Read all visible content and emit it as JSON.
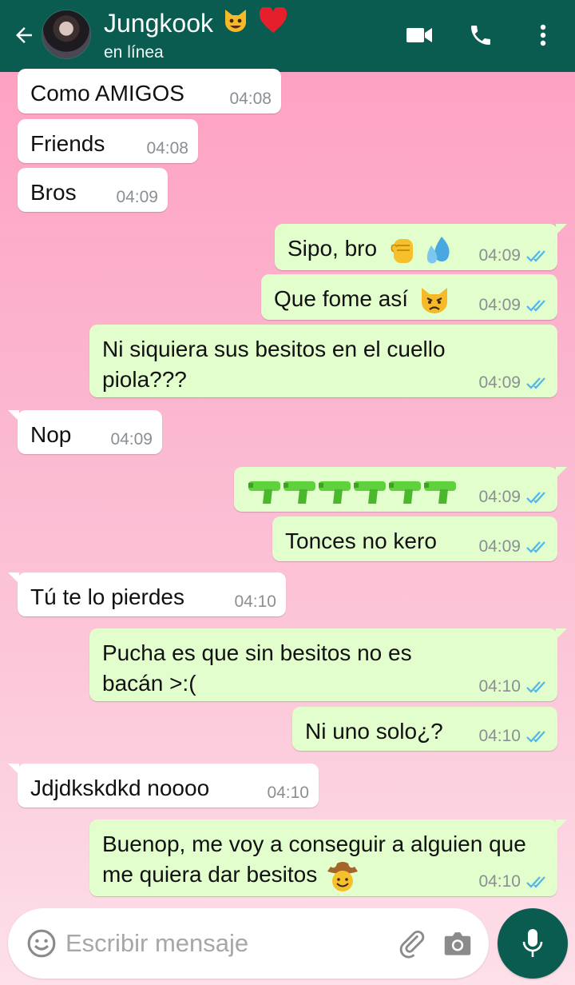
{
  "header": {
    "contact_name": "Jungkook",
    "status": "en línea",
    "name_emojis": [
      "smiling-cat-emoji",
      "red-heart-emoji"
    ],
    "bg_color": "#0b5c50",
    "actions": [
      "video-call-icon",
      "phone-icon",
      "more-options-icon"
    ]
  },
  "messages": [
    {
      "dir": "in",
      "text": "Como AMIGOS",
      "time": "04:08"
    },
    {
      "dir": "in",
      "text": "Friends",
      "time": "04:08"
    },
    {
      "dir": "in",
      "text": "Bros",
      "time": "04:09"
    },
    {
      "dir": "out",
      "text": "Sipo, bro",
      "time": "04:09",
      "emojis": [
        "raised-fist-emoji",
        "sweat-droplets-emoji"
      ],
      "status": "read"
    },
    {
      "dir": "out",
      "text": "Que fome así",
      "time": "04:09",
      "emojis": [
        "pouting-cat-emoji"
      ],
      "status": "read"
    },
    {
      "dir": "out",
      "text": "Ni siquiera sus besitos en el cuello piola???",
      "time": "04:09",
      "status": "read"
    },
    {
      "dir": "in",
      "text": "Nop",
      "time": "04:09"
    },
    {
      "dir": "out",
      "text": "",
      "time": "04:09",
      "emojis": [
        "water-pistol-emoji",
        "water-pistol-emoji",
        "water-pistol-emoji",
        "water-pistol-emoji",
        "water-pistol-emoji",
        "water-pistol-emoji"
      ],
      "status": "read"
    },
    {
      "dir": "out",
      "text": "Tonces no kero",
      "time": "04:09",
      "status": "read"
    },
    {
      "dir": "in",
      "text": "Tú te lo pierdes",
      "time": "04:10"
    },
    {
      "dir": "out",
      "text": "Pucha es que sin besitos no es bacán >:(",
      "time": "04:10",
      "status": "read"
    },
    {
      "dir": "out",
      "text": "Ni uno solo¿?",
      "time": "04:10",
      "status": "read"
    },
    {
      "dir": "in",
      "text": "Jdjdkskdkd noooo",
      "time": "04:10"
    },
    {
      "dir": "out",
      "text": "Buenop, me voy a conseguir a alguien que me quiera dar besitos",
      "time": "04:10",
      "emojis": [
        "cowboy-face-emoji"
      ],
      "status": "read"
    }
  ],
  "composer": {
    "placeholder": "Escribir mensaje",
    "icons": [
      "emoji-icon",
      "attach-icon",
      "camera-icon",
      "mic-icon"
    ]
  },
  "colors": {
    "incoming_bubble": "#ffffff",
    "outgoing_bubble": "#e2fecd",
    "read_ticks": "#4fb6ec",
    "accent": "#0b5c50"
  }
}
